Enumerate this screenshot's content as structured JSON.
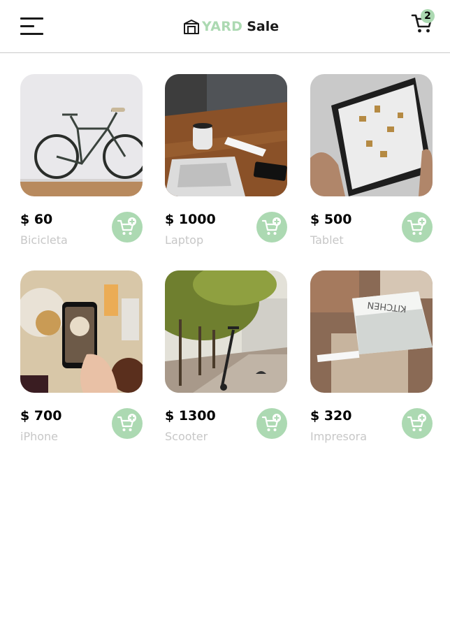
{
  "header": {
    "menu_icon": "hamburger-menu-icon",
    "logo": {
      "part1": "YARD",
      "part2": "Sale",
      "icon": "shop-building-icon"
    },
    "cart": {
      "icon": "shopping-cart-icon",
      "count": "2"
    }
  },
  "colors": {
    "accent": "#acd9b2",
    "text": "#000000",
    "muted": "#c7c7c7",
    "divider": "#c9c9c9"
  },
  "products": [
    {
      "price": "$ 60",
      "name": "Bicicleta",
      "image": "bicycle-photo",
      "add_icon": "add-to-cart-icon"
    },
    {
      "price": "$ 1000",
      "name": "Laptop",
      "image": "laptop-desk-photo",
      "add_icon": "add-to-cart-icon"
    },
    {
      "price": "$ 500",
      "name": "Tablet",
      "image": "tablet-photo",
      "add_icon": "add-to-cart-icon"
    },
    {
      "price": "$ 700",
      "name": "iPhone",
      "image": "phone-photo",
      "add_icon": "add-to-cart-icon"
    },
    {
      "price": "$ 1300",
      "name": "Scooter",
      "image": "scooter-photo",
      "add_icon": "add-to-cart-icon"
    },
    {
      "price": "$ 320",
      "name": "Impresora",
      "image": "printer-photo",
      "add_icon": "add-to-cart-icon"
    }
  ]
}
